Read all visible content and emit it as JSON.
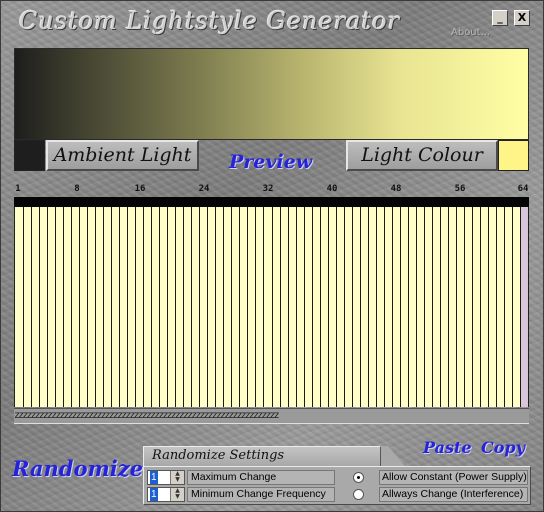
{
  "window": {
    "title": "Custom Lightstyle Generator",
    "about_label": "About...",
    "minimize_glyph": "_",
    "close_glyph": "X"
  },
  "colors": {
    "ambient_swatch": "#1e1e1e",
    "light_swatch": "#fff487",
    "accent_text": "#2424d6",
    "frame_fill": "#ffffc8"
  },
  "gradient": {
    "from": "#1d1d1d",
    "to": "#fffea4"
  },
  "buttons": {
    "ambient": "Ambient Light",
    "preview": "Preview",
    "light_colour": "Light Colour",
    "randomize": "Randomize",
    "paste": "Paste",
    "copy": "Copy"
  },
  "ruler": {
    "ticks": [
      "1",
      "8",
      "16",
      "24",
      "32",
      "40",
      "48",
      "56",
      "64"
    ]
  },
  "frames": {
    "count": 64,
    "pattern": "zzzzzzzzzzzzzzzzzzzzzzzzzzzzzzzzzzzzzzzzzzzzzzzzzzzzzzzzzzzzzzzz"
  },
  "randomize_settings": {
    "header": "Randomize Settings",
    "maximum_change": {
      "value": "1",
      "label": "Maximum Change"
    },
    "min_change_frequency": {
      "value": "1",
      "label": "Minimum Change Frequency"
    },
    "mode_options": [
      {
        "label": "Allow Constant (Power Supply)",
        "selected": true
      },
      {
        "label": "Allways Change (Interference)",
        "selected": false
      }
    ]
  }
}
